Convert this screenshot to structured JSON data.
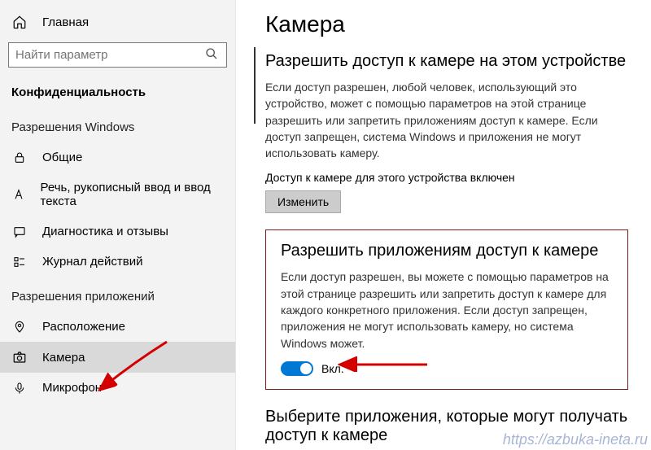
{
  "sidebar": {
    "home": "Главная",
    "search_placeholder": "Найти параметр",
    "privacy": "Конфиденциальность",
    "section_windows": "Разрешения Windows",
    "items_windows": [
      {
        "label": "Общие"
      },
      {
        "label": "Речь, рукописный ввод и ввод текста"
      },
      {
        "label": "Диагностика и отзывы"
      },
      {
        "label": "Журнал действий"
      }
    ],
    "section_apps": "Разрешения приложений",
    "items_apps": [
      {
        "label": "Расположение"
      },
      {
        "label": "Камера"
      },
      {
        "label": "Микрофон"
      }
    ]
  },
  "content": {
    "title": "Камера",
    "sec1": {
      "heading": "Разрешить доступ к камере на этом устройстве",
      "para": "Если доступ разрешен, любой человек, использующий это устройство, может с помощью параметров на этой странице разрешить или запретить приложениям доступ к камере. Если доступ запрещен, система Windows и приложения не могут использовать камеру.",
      "status": "Доступ к камере для этого устройства включен",
      "button": "Изменить"
    },
    "sec2": {
      "heading": "Разрешить приложениям доступ к камере",
      "para": "Если доступ разрешен, вы можете с помощью параметров на этой странице разрешить или запретить доступ к камере для каждого конкретного приложения. Если доступ запрещен, приложения не могут использовать камеру, но система Windows может.",
      "toggle_label": "Вкл."
    },
    "sec3": {
      "heading": "Выберите приложения, которые могут получать доступ к камере"
    }
  },
  "watermark": "https://azbuka-ineta.ru"
}
